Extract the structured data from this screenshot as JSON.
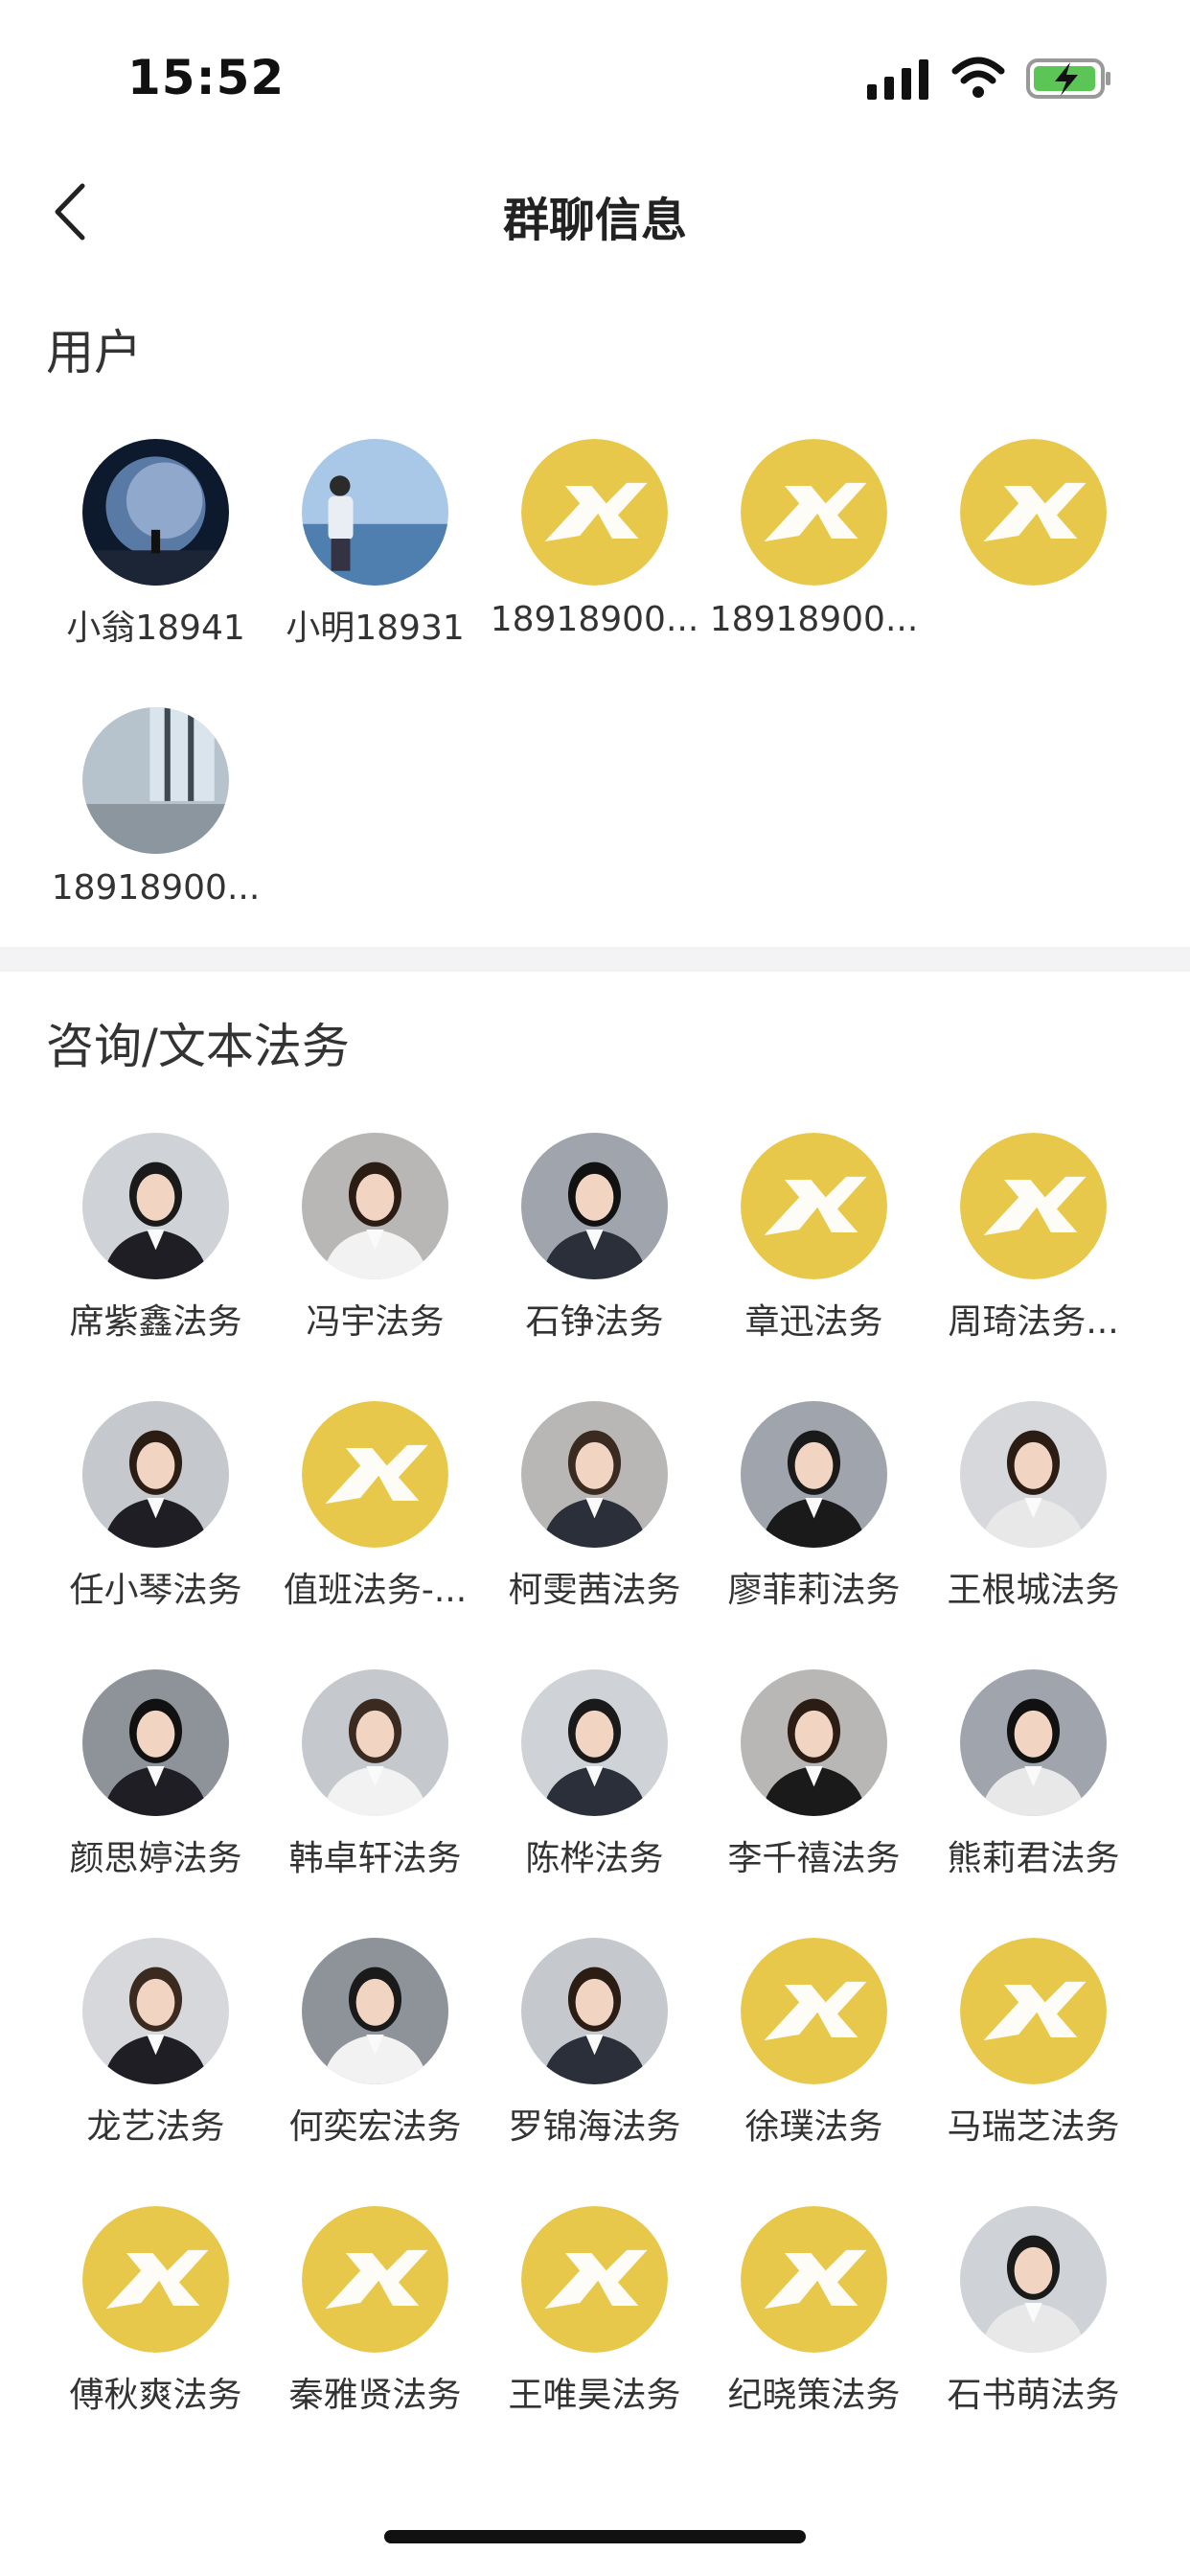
{
  "status_bar": {
    "time": "15:52"
  },
  "nav": {
    "title": "群聊信息"
  },
  "users_section": {
    "title": "用户",
    "members": [
      {
        "name": "小翁18941",
        "avatar": "moon-night-photo"
      },
      {
        "name": "小明18931",
        "avatar": "man-by-sea-photo"
      },
      {
        "name": "18918900...",
        "avatar": "yellow-app-logo"
      },
      {
        "name": "18918900...",
        "avatar": "yellow-app-logo"
      },
      {
        "name": "",
        "avatar": "yellow-app-logo"
      },
      {
        "name": "18918900...",
        "avatar": "window-photo"
      }
    ]
  },
  "legal_section": {
    "title": "咨询/文本法务",
    "members": [
      {
        "name": "席紫鑫法务",
        "avatar": "portrait-photo"
      },
      {
        "name": "冯宇法务",
        "avatar": "portrait-photo"
      },
      {
        "name": "石铮法务",
        "avatar": "portrait-photo"
      },
      {
        "name": "章迅法务",
        "avatar": "yellow-app-logo"
      },
      {
        "name": "周琦法务...",
        "avatar": "yellow-app-logo"
      },
      {
        "name": "任小琴法务",
        "avatar": "portrait-photo"
      },
      {
        "name": "值班法务-...",
        "avatar": "yellow-app-logo"
      },
      {
        "name": "柯雯茜法务",
        "avatar": "portrait-photo"
      },
      {
        "name": "廖菲莉法务",
        "avatar": "portrait-photo"
      },
      {
        "name": "王根城法务",
        "avatar": "portrait-photo"
      },
      {
        "name": "颜思婷法务",
        "avatar": "portrait-photo"
      },
      {
        "name": "韩卓轩法务",
        "avatar": "portrait-photo"
      },
      {
        "name": "陈桦法务",
        "avatar": "portrait-photo"
      },
      {
        "name": "李千禧法务",
        "avatar": "portrait-photo"
      },
      {
        "name": "熊莉君法务",
        "avatar": "portrait-photo"
      },
      {
        "name": "龙艺法务",
        "avatar": "portrait-photo"
      },
      {
        "name": "何奕宏法务",
        "avatar": "portrait-photo"
      },
      {
        "name": "罗锦海法务",
        "avatar": "portrait-photo"
      },
      {
        "name": "徐璞法务",
        "avatar": "yellow-app-logo"
      },
      {
        "name": "马瑞芝法务",
        "avatar": "yellow-app-logo"
      },
      {
        "name": "傅秋爽法务",
        "avatar": "yellow-app-logo"
      },
      {
        "name": "秦雅贤法务",
        "avatar": "yellow-app-logo"
      },
      {
        "name": "王唯昊法务",
        "avatar": "yellow-app-logo"
      },
      {
        "name": "纪晓策法务",
        "avatar": "yellow-app-logo"
      },
      {
        "name": "石书萌法务",
        "avatar": "portrait-photo"
      }
    ]
  },
  "colors": {
    "logo_yellow": "#E8C84A",
    "divider": "#F3F3F5"
  }
}
